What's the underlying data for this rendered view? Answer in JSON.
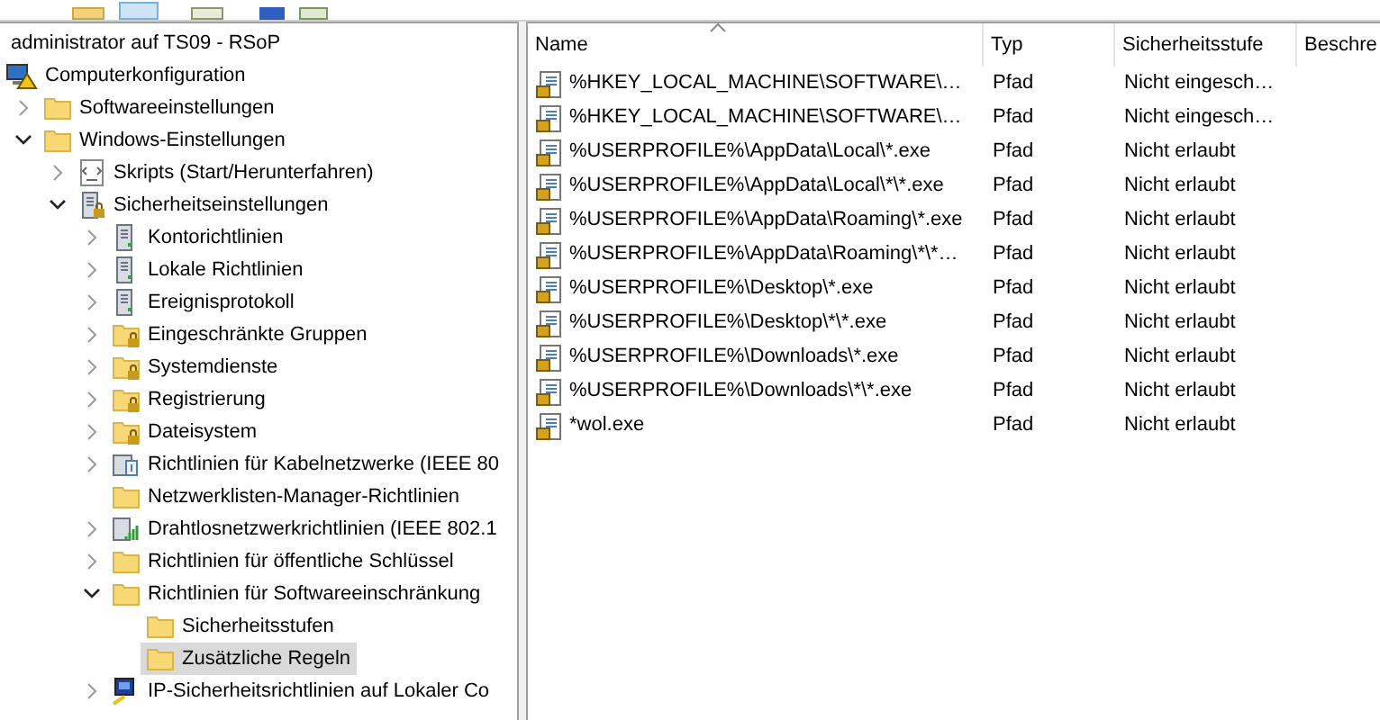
{
  "tree": {
    "root_label": "administrator auf TS09 - RSoP",
    "items": [
      {
        "label": "Computerkonfiguration",
        "kind": "computer",
        "selected": false,
        "children": [
          {
            "label": "Softwareeinstellungen",
            "kind": "folder",
            "expanded": false,
            "selected": false
          },
          {
            "label": "Windows-Einstellungen",
            "kind": "folder",
            "expanded": true,
            "selected": false,
            "children": [
              {
                "label": "Skripts (Start/Herunterfahren)",
                "kind": "script",
                "expanded": false,
                "selected": false
              },
              {
                "label": "Sicherheitseinstellungen",
                "kind": "server_lock",
                "expanded": true,
                "selected": false,
                "children": [
                  {
                    "label": "Kontorichtlinien",
                    "kind": "server",
                    "expanded": false,
                    "selected": false
                  },
                  {
                    "label": "Lokale Richtlinien",
                    "kind": "server",
                    "expanded": false,
                    "selected": false
                  },
                  {
                    "label": "Ereignisprotokoll",
                    "kind": "server",
                    "expanded": false,
                    "selected": false
                  },
                  {
                    "label": "Eingeschränkte Gruppen",
                    "kind": "folder_lock",
                    "expanded": false,
                    "selected": false
                  },
                  {
                    "label": "Systemdienste",
                    "kind": "folder_lock",
                    "expanded": false,
                    "selected": false
                  },
                  {
                    "label": "Registrierung",
                    "kind": "folder_lock",
                    "expanded": false,
                    "selected": false
                  },
                  {
                    "label": "Dateisystem",
                    "kind": "folder_lock",
                    "expanded": false,
                    "selected": false
                  },
                  {
                    "label": "Richtlinien für Kabelnetzwerke (IEEE 80",
                    "kind": "network",
                    "expanded": false,
                    "selected": false
                  },
                  {
                    "label": "Netzwerklisten-Manager-Richtlinien",
                    "kind": "folder",
                    "selected": false
                  },
                  {
                    "label": "Drahtlosnetzwerkrichtlinien (IEEE 802.1",
                    "kind": "wireless",
                    "expanded": false,
                    "selected": false
                  },
                  {
                    "label": "Richtlinien für öffentliche Schlüssel",
                    "kind": "folder",
                    "expanded": false,
                    "selected": false
                  },
                  {
                    "label": "Richtlinien für Softwareeinschränkung",
                    "kind": "folder",
                    "expanded": true,
                    "selected": false,
                    "children": [
                      {
                        "label": "Sicherheitsstufen",
                        "kind": "folder",
                        "selected": false
                      },
                      {
                        "label": "Zusätzliche Regeln",
                        "kind": "folder",
                        "selected": true
                      }
                    ]
                  },
                  {
                    "label": "IP-Sicherheitsrichtlinien auf Lokaler Co",
                    "kind": "ipsec",
                    "expanded": false,
                    "selected": false
                  }
                ]
              }
            ]
          }
        ]
      }
    ]
  },
  "list": {
    "columns": [
      {
        "label": "Name",
        "sorted": true
      },
      {
        "label": "Typ",
        "sorted": false
      },
      {
        "label": "Sicherheitsstufe",
        "sorted": false
      },
      {
        "label": "Beschre",
        "sorted": false
      }
    ],
    "rows": [
      {
        "name": "%HKEY_LOCAL_MACHINE\\SOFTWARE\\…",
        "type": "Pfad",
        "level": "Nicht eingesch…"
      },
      {
        "name": "%HKEY_LOCAL_MACHINE\\SOFTWARE\\…",
        "type": "Pfad",
        "level": "Nicht eingesch…"
      },
      {
        "name": "%USERPROFILE%\\AppData\\Local\\*.exe",
        "type": "Pfad",
        "level": "Nicht erlaubt"
      },
      {
        "name": "%USERPROFILE%\\AppData\\Local\\*\\*.exe",
        "type": "Pfad",
        "level": "Nicht erlaubt"
      },
      {
        "name": "%USERPROFILE%\\AppData\\Roaming\\*.exe",
        "type": "Pfad",
        "level": "Nicht erlaubt"
      },
      {
        "name": "%USERPROFILE%\\AppData\\Roaming\\*\\*…",
        "type": "Pfad",
        "level": "Nicht erlaubt"
      },
      {
        "name": "%USERPROFILE%\\Desktop\\*.exe",
        "type": "Pfad",
        "level": "Nicht erlaubt"
      },
      {
        "name": "%USERPROFILE%\\Desktop\\*\\*.exe",
        "type": "Pfad",
        "level": "Nicht erlaubt"
      },
      {
        "name": "%USERPROFILE%\\Downloads\\*.exe",
        "type": "Pfad",
        "level": "Nicht erlaubt"
      },
      {
        "name": "%USERPROFILE%\\Downloads\\*\\*.exe",
        "type": "Pfad",
        "level": "Nicht erlaubt"
      },
      {
        "name": "*wol.exe",
        "type": "Pfad",
        "level": "Nicht erlaubt"
      }
    ]
  }
}
